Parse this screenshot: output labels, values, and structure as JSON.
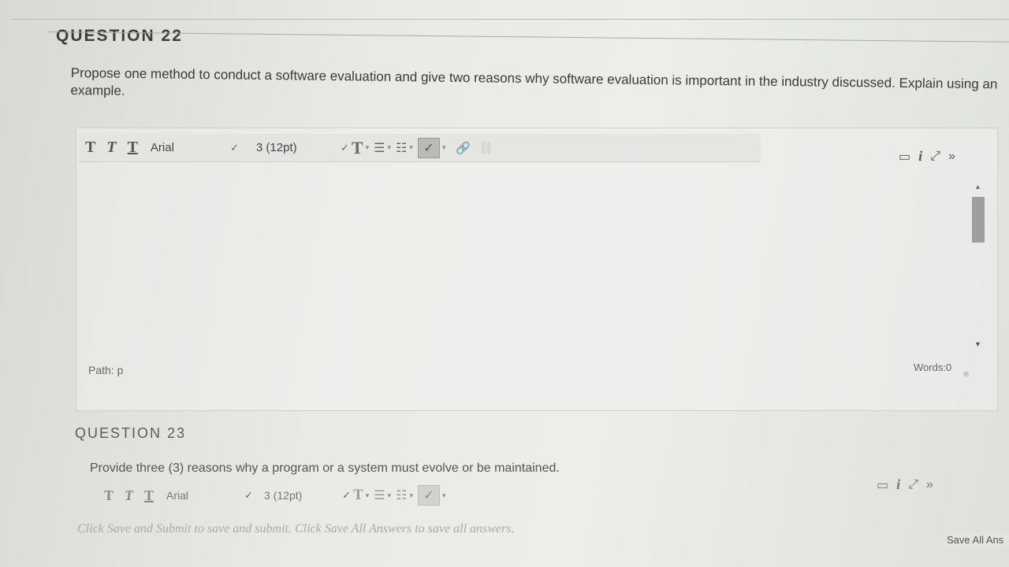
{
  "q22": {
    "heading": "QUESTION 22",
    "text": "Propose one method to conduct a software evaluation and give two reasons why software evaluation is important in the industry discussed. Explain using an example.",
    "toolbar": {
      "bold": "T",
      "italic": "T",
      "underline": "T",
      "font_value": "Arial",
      "size_value": "3 (12pt)",
      "text_color": "T",
      "bullet_list": "☰",
      "numbered_list": "☷",
      "spell": "✓",
      "link": "🔗",
      "unlink": "⛓"
    },
    "right_icons": {
      "preview": "▭",
      "info": "i",
      "fullscreen": "⤢",
      "collapse": "»"
    },
    "path_label": "Path: p",
    "words_label": "Words:0"
  },
  "q23": {
    "heading": "QUESTION 23",
    "text": "Provide three (3) reasons why a program or a system must evolve or be maintained.",
    "toolbar": {
      "bold": "T",
      "italic": "T",
      "underline": "T",
      "font_value": "Arial",
      "size_value": "3 (12pt)",
      "text_color": "T",
      "bullet_list": "☰",
      "numbered_list": "☷",
      "spell": "✓"
    },
    "right_icons": {
      "preview": "▭",
      "info": "i",
      "fullscreen": "⤢",
      "collapse": "»"
    }
  },
  "footer": {
    "note": "Click Save and Submit to save and submit. Click Save All Answers to save all answers.",
    "save_all": "Save All Ans"
  }
}
